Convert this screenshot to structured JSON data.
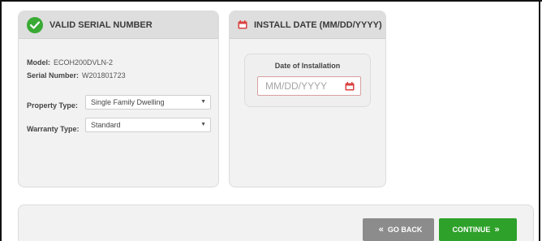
{
  "serial_panel": {
    "title": "VALID SERIAL NUMBER",
    "model_label": "Model:",
    "model_value": "ECOH200DVLN-2",
    "serial_label": "Serial Number:",
    "serial_value": "W201801723",
    "property_type_label": "Property Type:",
    "property_type_value": "Single Family Dwelling",
    "warranty_type_label": "Warranty Type:",
    "warranty_type_value": "Standard"
  },
  "install_panel": {
    "title": "INSTALL DATE (MM/DD/YYYY)",
    "date_card_title": "Date of Installation",
    "date_placeholder": "MM/DD/YYYY"
  },
  "footer": {
    "go_back_label": "GO BACK",
    "continue_label": "CONTINUE",
    "go_back_chevron": "«",
    "continue_chevron": "»"
  },
  "icons": {
    "check": "check-circle-icon",
    "calendar": "calendar-icon",
    "dropdown": "chevron-down-icon"
  },
  "colors": {
    "success_green": "#3aaa35",
    "continue_green": "#2ea12a",
    "go_back_gray": "#8c8c8c",
    "calendar_red": "#d9413f"
  }
}
